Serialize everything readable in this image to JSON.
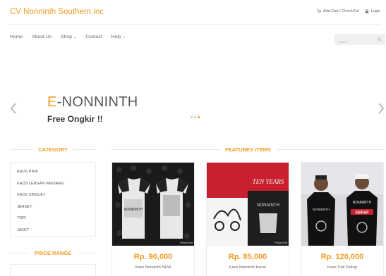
{
  "header": {
    "brand": "CV Nonninth Southern.inc",
    "cart_label": "Add Cart / CheckOut",
    "login_label": "Login"
  },
  "nav": {
    "items": [
      {
        "label": "Home"
      },
      {
        "label": "About Us"
      },
      {
        "label": "Shop"
      },
      {
        "label": "Contact"
      },
      {
        "label": "Help"
      }
    ]
  },
  "search": {
    "placeholder": "Search"
  },
  "slider": {
    "title_first_letter": "E",
    "title_rest": "-NONNINTH",
    "subtitle": "Free Ongkir !!",
    "active_dot": 3,
    "dot_count": 3
  },
  "sidebar": {
    "category_heading": "CATEGORY",
    "categories": [
      "KAOS PRIA",
      "KAOS LENGAN PANJANG",
      "KAOS SINGLET",
      "JERSEY",
      "TOPI",
      "JAKET"
    ],
    "price_heading": "PRICE RANGE"
  },
  "features": {
    "heading": "FEATURES ITEMS",
    "products": [
      {
        "price": "Rp. 90,000",
        "name": "Kaos Nonninth NEW",
        "watermark": "PhotoGrid"
      },
      {
        "price": "Rp. 85,000",
        "name": "Kaos Nonninth Keren",
        "watermark": "PhotoGrid"
      },
      {
        "price": "Rp. 120,000",
        "name": "Kaos Trail Sidrap"
      }
    ]
  },
  "colors": {
    "accent": "#f39c24",
    "text": "#333333",
    "muted": "#666666",
    "border": "#ececec"
  }
}
